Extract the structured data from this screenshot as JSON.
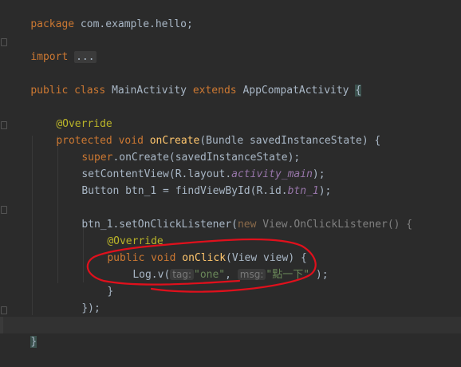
{
  "editor": {
    "lines": {
      "package": {
        "kw": "package",
        "rest": " com.example.hello;"
      },
      "import": {
        "kw": "import",
        "fold": "..."
      },
      "class": {
        "kw1": "public",
        "kw2": "class",
        "name": "MainActivity",
        "kw3": "extends",
        "super": "AppCompatActivity",
        "brace": "{"
      },
      "override1": "@Override",
      "oncreate": {
        "kw1": "protected",
        "kw2": "void",
        "method": "onCreate",
        "params": "(Bundle savedInstanceState) {"
      },
      "super_call": {
        "kw": "super",
        "rest": ".onCreate(savedInstanceState);"
      },
      "setcontent": {
        "pre": "setContentView(R.layout.",
        "field": "activity_main",
        "post": ");"
      },
      "button": {
        "pre": "Button btn_1 = findViewById(R.id.",
        "field": "btn_1",
        "post": ");"
      },
      "listener": {
        "pre": "btn_1.setOnClickListener(",
        "kw": "new",
        "anon": " View.OnClickListener() {",
        "close": ""
      },
      "override2": "@Override",
      "onclick": {
        "kw1": "public",
        "kw2": "void",
        "method": "onClick",
        "params": "(View view) {"
      },
      "log": {
        "pre": "Log.v(",
        "hint1": "tag:",
        "str1": "\"one\"",
        "comma": ",",
        "hint2": "msg:",
        "str2": "\"點一下\"",
        "post": ");"
      },
      "close_method": "}",
      "close_listener": "});",
      "close_oncreate": "}",
      "close_class": "}"
    }
  },
  "colors": {
    "background": "#2b2b2b",
    "current_line": "#323232",
    "keyword": "#cc7832",
    "annotation": "#bbb529",
    "method": "#ffc66d",
    "string": "#6a8759",
    "field": "#9876aa",
    "text": "#a9b7c6",
    "annotation_circle": "#e0101c"
  }
}
